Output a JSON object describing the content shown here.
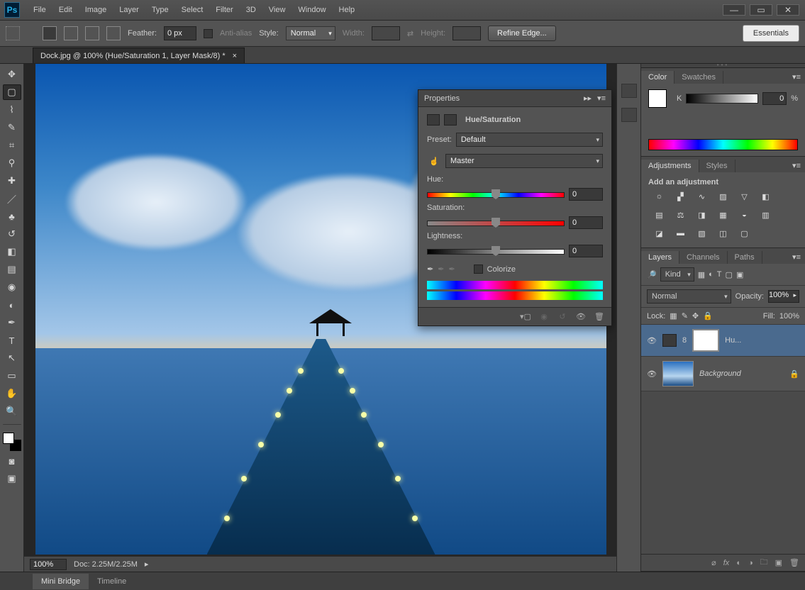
{
  "menubar": {
    "items": [
      "File",
      "Edit",
      "Image",
      "Layer",
      "Type",
      "Select",
      "Filter",
      "3D",
      "View",
      "Window",
      "Help"
    ]
  },
  "optbar": {
    "feather_label": "Feather:",
    "feather_value": "0 px",
    "antialias": "Anti-alias",
    "style_label": "Style:",
    "style_value": "Normal",
    "width_label": "Width:",
    "height_label": "Height:",
    "refine": "Refine Edge...",
    "workspace": "Essentials"
  },
  "doc": {
    "tab_title": "Dock.jpg @ 100% (Hue/Saturation 1, Layer Mask/8) *"
  },
  "properties": {
    "title": "Properties",
    "section": "Hue/Saturation",
    "preset_label": "Preset:",
    "preset_value": "Default",
    "channel_value": "Master",
    "hue_label": "Hue:",
    "hue_value": "0",
    "sat_label": "Saturation:",
    "sat_value": "0",
    "lig_label": "Lightness:",
    "lig_value": "0",
    "colorize": "Colorize"
  },
  "color_panel": {
    "tab1": "Color",
    "tab2": "Swatches",
    "mode": "K",
    "value": "0",
    "unit": "%"
  },
  "adjustments": {
    "tab1": "Adjustments",
    "tab2": "Styles",
    "heading": "Add an adjustment"
  },
  "layers": {
    "tab1": "Layers",
    "tab2": "Channels",
    "tab3": "Paths",
    "kind": "Kind",
    "blend": "Normal",
    "opacity_label": "Opacity:",
    "opacity_value": "100%",
    "lock_label": "Lock:",
    "fill_label": "Fill:",
    "fill_value": "100%",
    "layer1_name": "Hu...",
    "layer2_name": "Background"
  },
  "status": {
    "zoom": "100%",
    "doc": "Doc: 2.25M/2.25M"
  },
  "bottom": {
    "tab1": "Mini Bridge",
    "tab2": "Timeline"
  }
}
